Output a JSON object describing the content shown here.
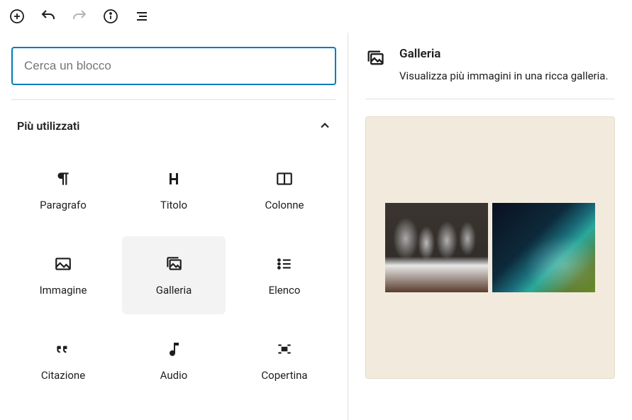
{
  "search": {
    "placeholder": "Cerca un blocco"
  },
  "sections": {
    "most_used": {
      "title": "Più utilizzati"
    }
  },
  "blocks": [
    {
      "label": "Paragrafo",
      "icon": "paragraph"
    },
    {
      "label": "Titolo",
      "icon": "heading"
    },
    {
      "label": "Colonne",
      "icon": "columns"
    },
    {
      "label": "Immagine",
      "icon": "image"
    },
    {
      "label": "Galleria",
      "icon": "gallery",
      "selected": true
    },
    {
      "label": "Elenco",
      "icon": "list"
    },
    {
      "label": "Citazione",
      "icon": "quote"
    },
    {
      "label": "Audio",
      "icon": "audio"
    },
    {
      "label": "Copertina",
      "icon": "cover"
    }
  ],
  "preview": {
    "title": "Galleria",
    "description": "Visualizza più immagini in una ricca galleria."
  }
}
